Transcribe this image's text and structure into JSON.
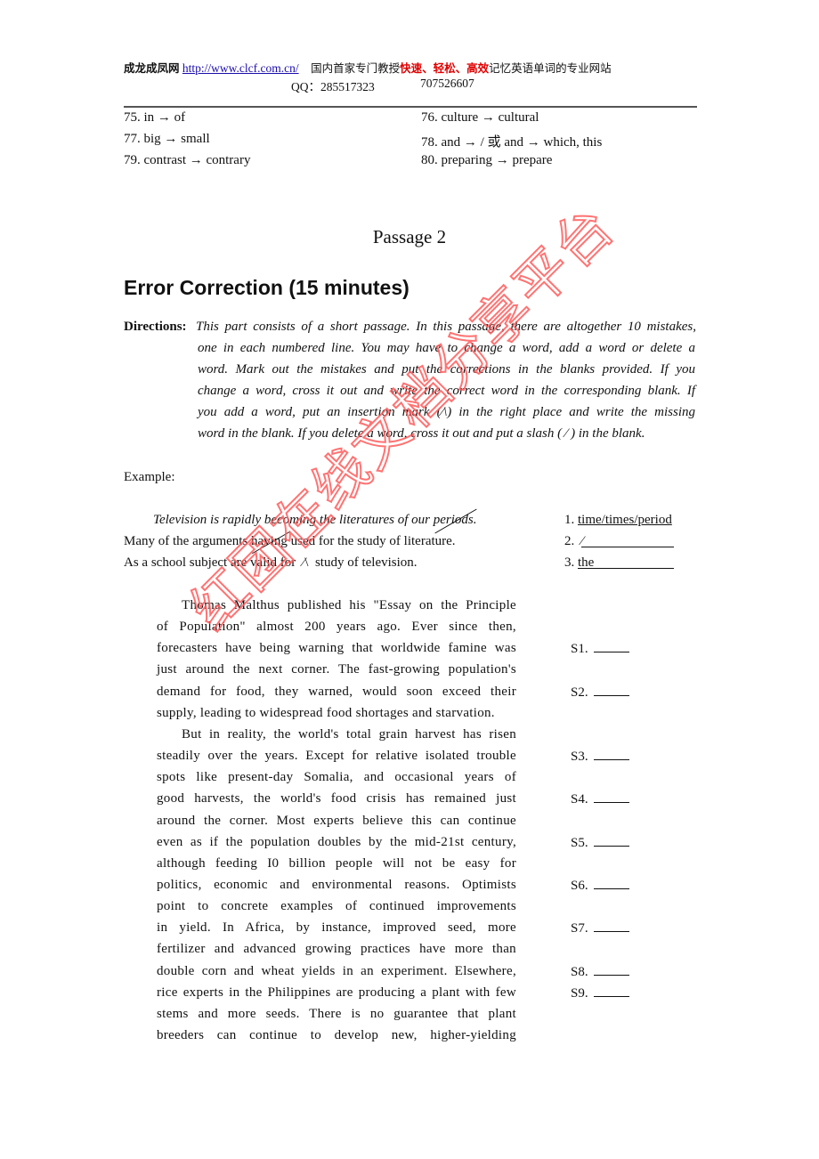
{
  "header": {
    "brand": "成龙成凤网",
    "url": "http://www.clcf.com.cn/",
    "tagline_pre": "国内首家专门教授",
    "tagline_red": "快速、轻松、高效",
    "tagline_post": "记忆英语单词的专业网站",
    "qq_label": "QQ：285517323",
    "qq2": "707526607"
  },
  "answers": [
    {
      "num": "75.",
      "text": "in → of"
    },
    {
      "num": "76.",
      "text": "culture → cultural"
    },
    {
      "num": "77.",
      "text": "big → small"
    },
    {
      "num": "78.",
      "text": "and → /  或  and → which, this"
    },
    {
      "num": "79.",
      "text": "contrast → contrary"
    },
    {
      "num": "80.",
      "text": "preparing → prepare"
    }
  ],
  "passage_title": "Passage 2",
  "section_title": "Error Correction (15 minutes)",
  "directions": {
    "label": "Directions:",
    "lines": [
      "This part consists of a short passage. In this passage, there are altogether 10 mistakes,",
      "one in each numbered line. You may have to change a word, add a word or delete a",
      "word. Mark out the mistakes and put the corrections in the blanks provided. If you",
      "change a word, cross it out and write the correct word in the corresponding blank. If",
      "you add a word, put an insertion mark (⁄\\) in the right place and write the missing",
      "word in the blank. If you delete a word, cross it out and put a slash ( ⁄ ) in the blank."
    ]
  },
  "example": {
    "label": "Example:",
    "line1_pre": "Television is rapidly becoming the literatures of our ",
    "line1_struck": "periods",
    "line1_post": ".",
    "line2_pre": "Many of the arguments ",
    "line2_struck": "having",
    "line2_post": " used for the study of literature.",
    "line3_pre": "As a school subject are valid for ",
    "line3_mark": "⁄\\",
    "line3_post": " study of television.",
    "answer1_num": "1.",
    "answer1": "time/times/period",
    "answer2_num": "2.",
    "answer2": "⁄",
    "answer3_num": "3.",
    "answer3": "the"
  },
  "passage_lines": [
    "Thomas Malthus published his \"Essay on the Principle",
    "of Population\" almost 200 years ago. Ever since then,",
    "forecasters have being warning that worldwide famine was",
    "just around the next corner. The fast-growing population's",
    "demand for food, they warned, would soon exceed their",
    "supply, leading to widespread food shortages and starvation.",
    "But in reality, the world's total grain harvest has risen",
    "steadily over the years. Except for relative isolated trouble",
    "spots like present-day Somalia, and occasional years of",
    "good harvests, the world's food crisis has remained just",
    "around the corner. Most experts believe this can continue",
    "even as if the population doubles by the mid-21st century,",
    "although feeding I0 billion people will not be easy for",
    "politics, economic and environmental reasons. Optimists",
    "point to concrete examples of continued improvements",
    "in yield. In Africa, by instance, improved seed, more",
    "fertilizer and advanced growing practices have more than",
    "double corn and wheat yields in an experiment. Elsewhere,",
    "rice experts in the Philippines are producing a plant with few",
    "stems and more seeds. There is no guarantee that plant",
    "breeders can continue to develop new, higher-yielding"
  ],
  "blank_labels": [
    "S1.",
    "S2.",
    "S3.",
    "S4.",
    "S5.",
    "S6.",
    "S7.",
    "S8.",
    "S9."
  ],
  "watermark": "红团在线文档分享平台"
}
